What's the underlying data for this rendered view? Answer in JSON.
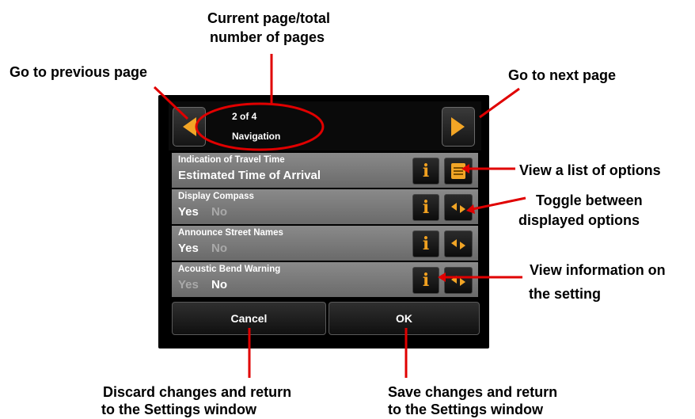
{
  "annotations": {
    "page_indicator": [
      "Current page/total",
      "number of pages"
    ],
    "prev_page": "Go to previous page",
    "next_page": "Go to next page",
    "view_list": "View a list of options",
    "toggle": [
      "Toggle between",
      "displayed options"
    ],
    "view_info": [
      "View information on",
      "the setting"
    ],
    "discard": [
      "Discard changes and return",
      "to the Settings window"
    ],
    "save": [
      "Save changes and return",
      "to the Settings window"
    ]
  },
  "header": {
    "page_count": "2 of 4",
    "title": "Navigation"
  },
  "settings": [
    {
      "label": "Indication of Travel Time",
      "options": [
        "Estimated Time of Arrival"
      ],
      "selected": 0,
      "action": "list"
    },
    {
      "label": "Display Compass",
      "options": [
        "Yes",
        "No"
      ],
      "selected": 0,
      "action": "toggle"
    },
    {
      "label": "Announce Street Names",
      "options": [
        "Yes",
        "No"
      ],
      "selected": 0,
      "action": "toggle"
    },
    {
      "label": "Acoustic Bend Warning",
      "options": [
        "Yes",
        "No"
      ],
      "selected": 1,
      "action": "toggle"
    }
  ],
  "footer": {
    "cancel_label": "Cancel",
    "ok_label": "OK"
  },
  "colors": {
    "accent_orange": "#f2a526",
    "annotation_red": "#e00000",
    "row_bg": "#7a7a7a"
  },
  "icons": {
    "prev": "triangle-left-icon",
    "next": "triangle-right-icon",
    "info": "info-icon",
    "list": "list-icon",
    "toggle": "toggle-arrows-icon"
  }
}
